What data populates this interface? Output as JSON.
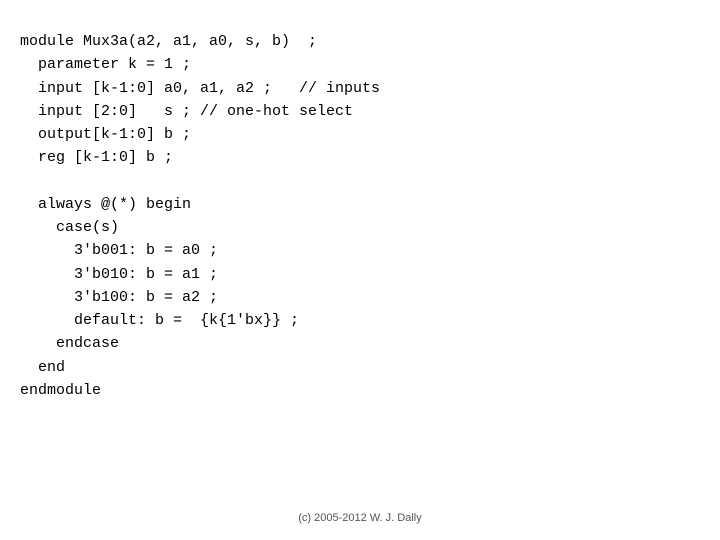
{
  "code": {
    "lines": [
      "module Mux3a(a2, a1, a0, s, b)  ;",
      "  parameter k = 1 ;",
      "  input [k-1:0] a0, a1, a2 ;   // inputs",
      "  input [2:0]   s ; // one-hot select",
      "  output[k-1:0] b ;",
      "  reg [k-1:0] b ;",
      "",
      "  always @(*) begin",
      "    case(s)",
      "      3'b001: b = a0 ;",
      "      3'b010: b = a1 ;",
      "      3'b100: b = a2 ;",
      "      default: b =  {k{1'bx}} ;",
      "    endcase",
      "  end",
      "endmodule"
    ]
  },
  "footer": {
    "text": "(c) 2005-2012 W. J. Dally"
  }
}
